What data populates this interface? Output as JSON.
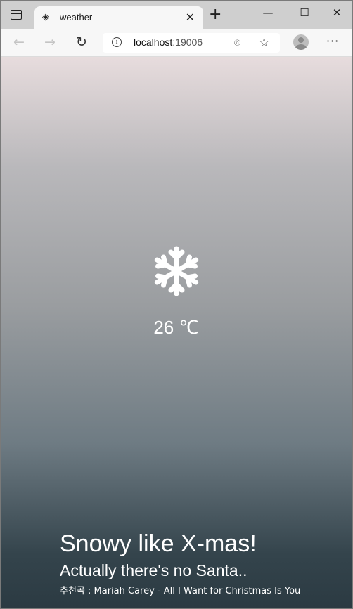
{
  "browser": {
    "tab_title": "weather",
    "url_host": "localhost",
    "url_port": ":19006",
    "icons": {
      "tab_actions": "tab-actions-icon",
      "favicon": "page-icon",
      "close": "close-icon",
      "new_tab": "plus-icon",
      "back": "back-arrow-icon",
      "forward": "forward-arrow-icon",
      "reload": "reload-icon",
      "site_info": "info-icon",
      "location": "location-icon",
      "favorites": "favorites-add-icon",
      "profile": "profile-icon",
      "more": "more-icon"
    }
  },
  "weather": {
    "icon": "snowflake-icon",
    "temperature": "26 ℃",
    "headline": "Snowy like X-mas!",
    "subline": "Actually there's no Santa..",
    "recommendation": "추천곡 : Mariah Carey - All I Want for Christmas Is You"
  },
  "colors": {
    "gradient_top": "#e7dcdd",
    "gradient_bottom": "#2b3a42",
    "text": "#ffffff"
  }
}
